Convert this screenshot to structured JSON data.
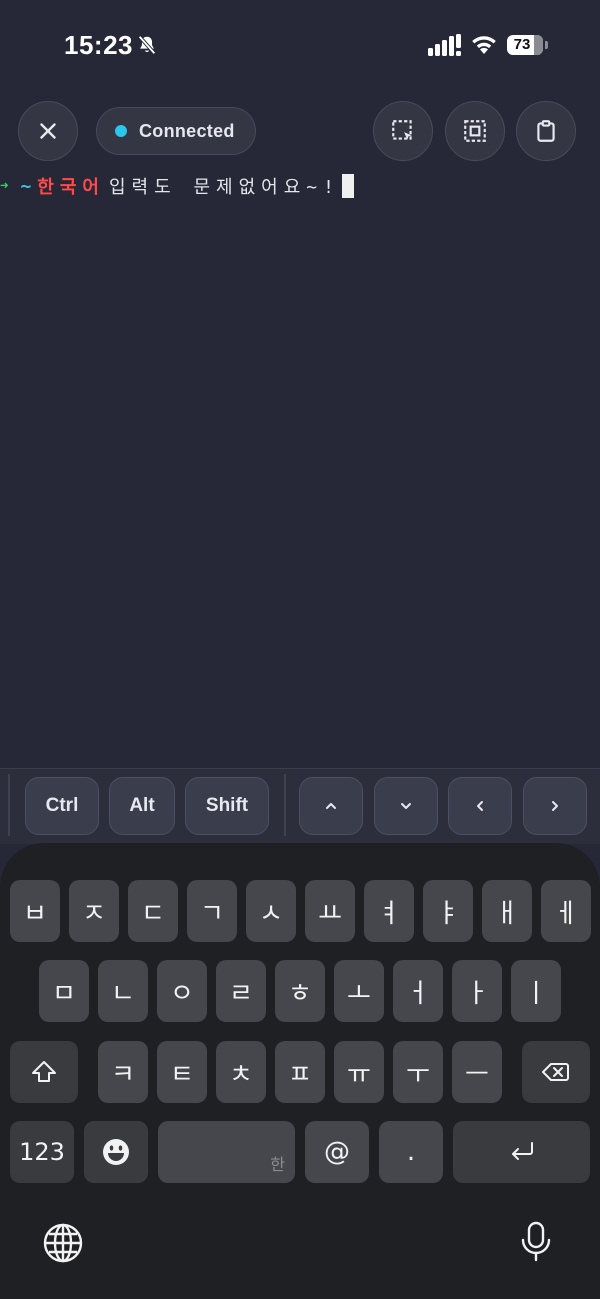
{
  "status_bar": {
    "time": "15:23",
    "battery_percent": "73",
    "icons": [
      "bell-slash-icon",
      "cellular-signal-icon",
      "wifi-icon",
      "battery-icon"
    ]
  },
  "toolbar": {
    "close_icon": "close-icon",
    "connection_label": "Connected",
    "connection_color": "#2bc6ec",
    "action_icons": [
      "select-region-icon",
      "select-all-icon",
      "clipboard-icon"
    ]
  },
  "terminal": {
    "prompt_arrow": "➜",
    "prompt_dir": "~",
    "command_highlight": "한국어",
    "command_text": "입력도 문제없어요~!",
    "colors": {
      "arrow": "#3fcf6a",
      "dir": "#3fc1e6",
      "highlight": "#ff4a4a"
    }
  },
  "extra_keys": {
    "ctrl": "Ctrl",
    "alt": "Alt",
    "shift": "Shift",
    "arrows": [
      "arrow-up-icon",
      "arrow-down-icon",
      "arrow-left-icon",
      "arrow-right-icon"
    ]
  },
  "keyboard": {
    "row1": [
      "ㅂ",
      "ㅈ",
      "ㄷ",
      "ㄱ",
      "ㅅ",
      "ㅛ",
      "ㅕ",
      "ㅑ",
      "ㅐ",
      "ㅔ"
    ],
    "row2": [
      "ㅁ",
      "ㄴ",
      "ㅇ",
      "ㄹ",
      "ㅎ",
      "ㅗ",
      "ㅓ",
      "ㅏ",
      "ㅣ"
    ],
    "row3": [
      "ㅋ",
      "ㅌ",
      "ㅊ",
      "ㅍ",
      "ㅠ",
      "ㅜ",
      "ㅡ"
    ],
    "numbers_label": "123",
    "space_hint": "한",
    "at_label": "@",
    "period_label": ".",
    "icons": [
      "shift-icon",
      "backspace-icon",
      "emoji-icon",
      "return-icon",
      "globe-icon",
      "microphone-icon"
    ]
  }
}
